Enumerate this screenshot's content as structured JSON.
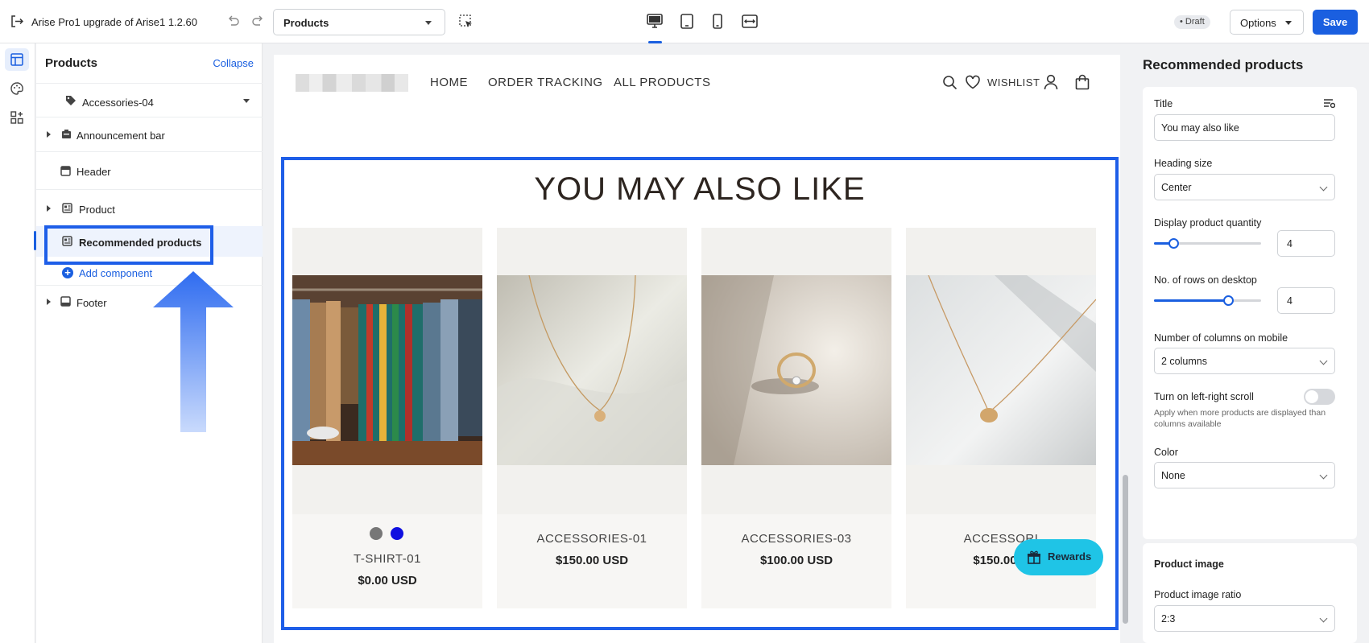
{
  "topbar": {
    "app_title": "Arise Pro1 upgrade of Arise1  1.2.60",
    "page_select": "Products",
    "status_badge": "• Draft",
    "options_label": "Options",
    "save_label": "Save"
  },
  "left_panel": {
    "title": "Products",
    "collapse_label": "Collapse",
    "template_select": "Accessories-04",
    "items": [
      {
        "label": "Announcement bar"
      },
      {
        "label": "Header"
      },
      {
        "label": "Product"
      },
      {
        "label": "Recommended products"
      }
    ],
    "add_component_label": "Add component",
    "footer_label": "Footer"
  },
  "store": {
    "nav": [
      "HOME",
      "ORDER TRACKING",
      "ALL PRODUCTS"
    ],
    "wishlist_label": "WISHLIST",
    "section_heading": "YOU MAY ALSO LIKE",
    "products": [
      {
        "name": "T-SHIRT-01",
        "price": "$0.00 USD",
        "swatches": [
          "#777777",
          "#1010e0"
        ]
      },
      {
        "name": "ACCESSORIES-01",
        "price": "$150.00 USD"
      },
      {
        "name": "ACCESSORIES-03",
        "price": "$100.00 USD"
      },
      {
        "name": "ACCESSORI",
        "price": "$150.00 U"
      }
    ],
    "rewards_label": "Rewards"
  },
  "right_panel": {
    "title": "Recommended products",
    "title_label": "Title",
    "title_value": "You may also like",
    "heading_size_label": "Heading size",
    "heading_size_value": "Center",
    "display_qty_label": "Display product quantity",
    "display_qty_value": "4",
    "display_qty_fraction": 0.18,
    "rows_label": "No. of rows on desktop",
    "rows_value": "4",
    "rows_fraction": 0.69,
    "mobile_cols_label": "Number of columns on mobile",
    "mobile_cols_value": "2 columns",
    "scroll_toggle_label": "Turn on left-right scroll",
    "scroll_toggle_help": "Apply when more products are displayed than columns available",
    "scroll_toggle_on": false,
    "color_label": "Color",
    "color_value": "None",
    "product_image_heading": "Product image",
    "image_ratio_label": "Product image ratio",
    "image_ratio_value": "2:3"
  },
  "colors": {
    "accent": "#1a5fe0",
    "rewards": "#1fc4e6"
  }
}
